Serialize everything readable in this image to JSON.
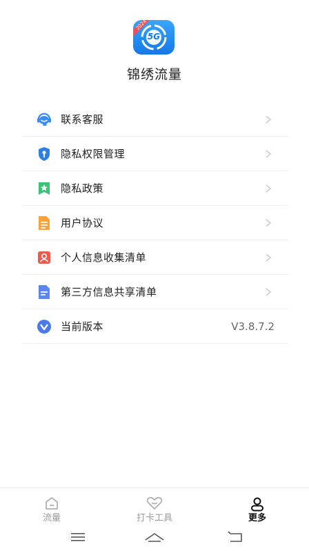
{
  "app": {
    "logo_badge": "2024",
    "logo_text": "5G",
    "name": "锦绣流量"
  },
  "menu": {
    "items": [
      {
        "label": "联系客服",
        "icon": "customer-service-icon"
      },
      {
        "label": "隐私权限管理",
        "icon": "privacy-shield-icon"
      },
      {
        "label": "隐私政策",
        "icon": "bookmark-icon"
      },
      {
        "label": "用户协议",
        "icon": "document-icon"
      },
      {
        "label": "个人信息收集清单",
        "icon": "person-card-icon"
      },
      {
        "label": "第三方信息共享清单",
        "icon": "share-list-icon"
      },
      {
        "label": "当前版本",
        "icon": "version-icon",
        "value": "V3.8.7.2"
      }
    ]
  },
  "tabbar": {
    "tabs": [
      {
        "label": "流量",
        "icon": "home-icon",
        "active": false
      },
      {
        "label": "打卡工具",
        "icon": "heart-icon",
        "active": false
      },
      {
        "label": "更多",
        "icon": "user-icon",
        "active": true
      }
    ]
  },
  "colors": {
    "accent": "#1677e8",
    "customer_service": "#3b8cf3",
    "shield": "#2f7fe0",
    "bookmark": "#3cc277",
    "document": "#ffa23a",
    "person": "#ef5a4f",
    "share": "#5b86f0",
    "version": "#4a7be8"
  }
}
